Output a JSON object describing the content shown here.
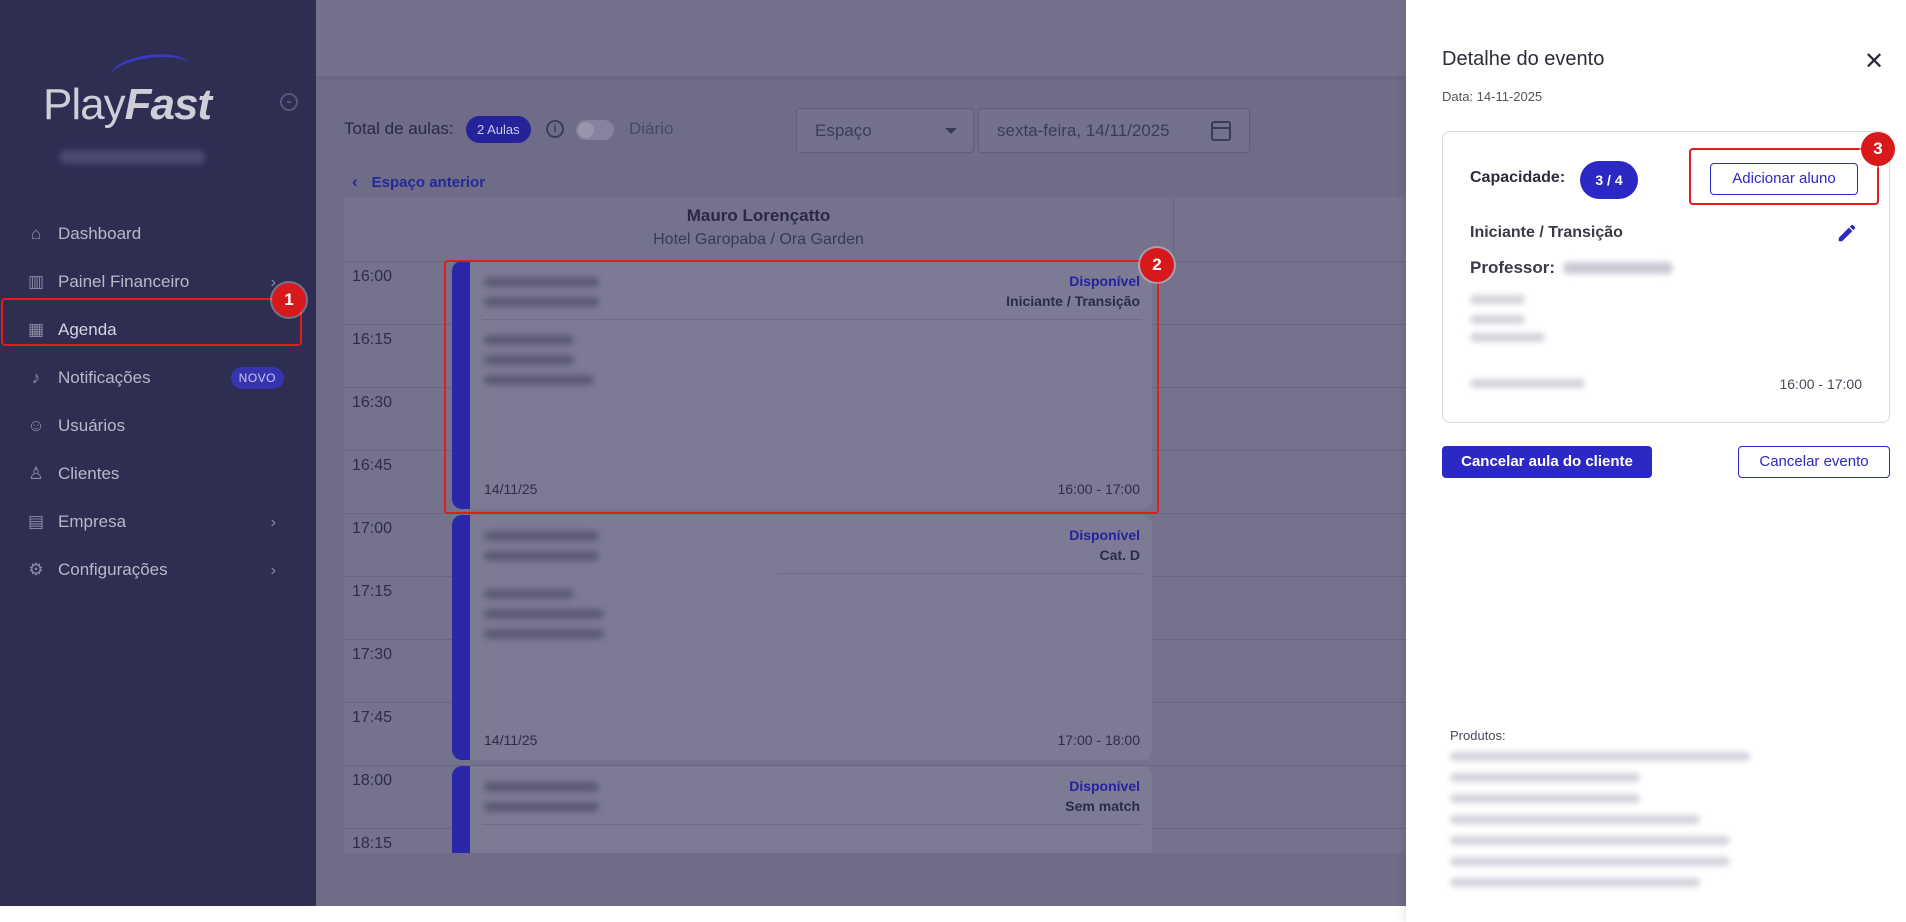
{
  "sidebar": {
    "logo_play": "Play",
    "logo_fast": "Fast",
    "items": [
      {
        "label": "Dashboard",
        "icon": "home-icon"
      },
      {
        "label": "Painel Financeiro",
        "icon": "chart-icon"
      },
      {
        "label": "Agenda",
        "icon": "calendar-icon"
      },
      {
        "label": "Notificações",
        "icon": "bell-icon",
        "badge": "NOVO"
      },
      {
        "label": "Usuários",
        "icon": "user-plus-icon"
      },
      {
        "label": "Clientes",
        "icon": "user-icon"
      },
      {
        "label": "Empresa",
        "icon": "building-icon"
      },
      {
        "label": "Configurações",
        "icon": "gear-icon"
      }
    ]
  },
  "toolbar": {
    "total_label": "Total de aulas:",
    "total_badge": "2 Aulas",
    "daily_label": "Diário",
    "space_placeholder": "Espaço",
    "date_value": "sexta-feira, 14/11/2025",
    "prev_space": "Espaço anterior"
  },
  "calendar": {
    "column_name": "Mauro Lorençatto",
    "column_place": "Hotel Garopaba / Ora Garden",
    "times": [
      "16:00",
      "16:15",
      "16:30",
      "16:45",
      "17:00",
      "17:15",
      "17:30",
      "17:45",
      "18:00",
      "18:15"
    ],
    "events": [
      {
        "status": "Disponível",
        "level": "Iniciante / Transição",
        "date": "14/11/25",
        "time": "16:00 - 17:00"
      },
      {
        "status": "Disponível",
        "level": "Cat. D",
        "date": "14/11/25",
        "time": "17:00 - 18:00"
      },
      {
        "status": "Disponível",
        "level": "Sem match"
      }
    ]
  },
  "panel": {
    "title": "Detalhe do evento",
    "date": "Data: 14-11-2025",
    "capacity_label": "Capacidade:",
    "capacity_value": "3 / 4",
    "add_student": "Adicionar aluno",
    "level": "Iniciante / Transição",
    "professor_label": "Professor:",
    "time": "16:00 - 17:00",
    "cancel_class": "Cancelar aula do cliente",
    "cancel_event": "Cancelar evento",
    "products_label": "Produtos:"
  },
  "annotations": [
    "1",
    "2",
    "3"
  ],
  "colors": {
    "accent": "#2b28c4",
    "highlight": "#e21b1b",
    "sidebar": "#2e2d52"
  }
}
